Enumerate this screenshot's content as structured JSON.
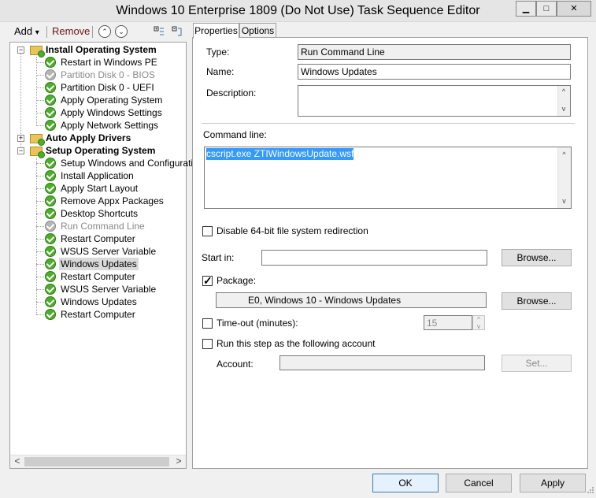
{
  "window": {
    "title": "Windows 10 Enterprise 1809 (Do Not Use) Task Sequence Editor",
    "minimize_glyph": "▁",
    "maximize_glyph": "□",
    "close_glyph": "✕"
  },
  "toolbar": {
    "add_label": "Add",
    "add_arrow": "▾",
    "remove_label": "Remove",
    "move_up_glyph": "⌃",
    "move_down_glyph": "⌄"
  },
  "tree": {
    "groups": [
      {
        "label": "Install Operating System",
        "expander": "−",
        "steps": [
          {
            "label": "Restart in Windows PE",
            "disabled": false
          },
          {
            "label": "Partition Disk 0 - BIOS",
            "disabled": true
          },
          {
            "label": "Partition Disk 0 - UEFI",
            "disabled": false
          },
          {
            "label": "Apply Operating System",
            "disabled": false
          },
          {
            "label": "Apply Windows Settings",
            "disabled": false
          },
          {
            "label": "Apply Network Settings",
            "disabled": false
          }
        ]
      },
      {
        "label": "Auto Apply Drivers",
        "expander": "+",
        "steps": []
      },
      {
        "label": "Setup Operating System",
        "expander": "−",
        "steps": [
          {
            "label": "Setup Windows and Configuration",
            "disabled": false
          },
          {
            "label": "Install Application",
            "disabled": false
          },
          {
            "label": "Apply Start Layout",
            "disabled": false
          },
          {
            "label": "Remove Appx Packages",
            "disabled": false
          },
          {
            "label": "Desktop Shortcuts",
            "disabled": false
          },
          {
            "label": "Run Command Line",
            "disabled": true
          },
          {
            "label": "Restart Computer",
            "disabled": false
          },
          {
            "label": "WSUS Server Variable",
            "disabled": false
          },
          {
            "label": "Windows Updates",
            "disabled": false,
            "selected": true
          },
          {
            "label": "Restart Computer",
            "disabled": false
          },
          {
            "label": "WSUS Server Variable",
            "disabled": false
          },
          {
            "label": "Windows Updates",
            "disabled": false
          },
          {
            "label": "Restart Computer",
            "disabled": false
          }
        ]
      }
    ],
    "scroll_left": "<",
    "scroll_right": ">"
  },
  "tabs": [
    {
      "label": "Properties",
      "active": true
    },
    {
      "label": "Options",
      "active": false
    }
  ],
  "properties": {
    "type_label": "Type:",
    "type_value": "Run Command Line",
    "name_label": "Name:",
    "name_value": "Windows Updates",
    "description_label": "Description:",
    "description_value": "",
    "command_line_label": "Command line:",
    "command_line_value": "cscript.exe ZTIWindowsUpdate.wsf",
    "disable64_label": "Disable 64-bit file system redirection",
    "disable64_checked": false,
    "start_in_label": "Start in:",
    "start_in_value": "",
    "browse_label": "Browse...",
    "package_label": "Package:",
    "package_checked": true,
    "package_value": "E0, Windows 10 - Windows Updates",
    "timeout_label": "Time-out (minutes):",
    "timeout_checked": false,
    "timeout_value": "15",
    "run_as_label": "Run this step as the following account",
    "run_as_checked": false,
    "account_label": "Account:",
    "account_value": "",
    "set_label": "Set...",
    "up_arrow": "^",
    "down_arrow": "v"
  },
  "footer": {
    "ok_label": "OK",
    "cancel_label": "Cancel",
    "apply_label": "Apply"
  }
}
